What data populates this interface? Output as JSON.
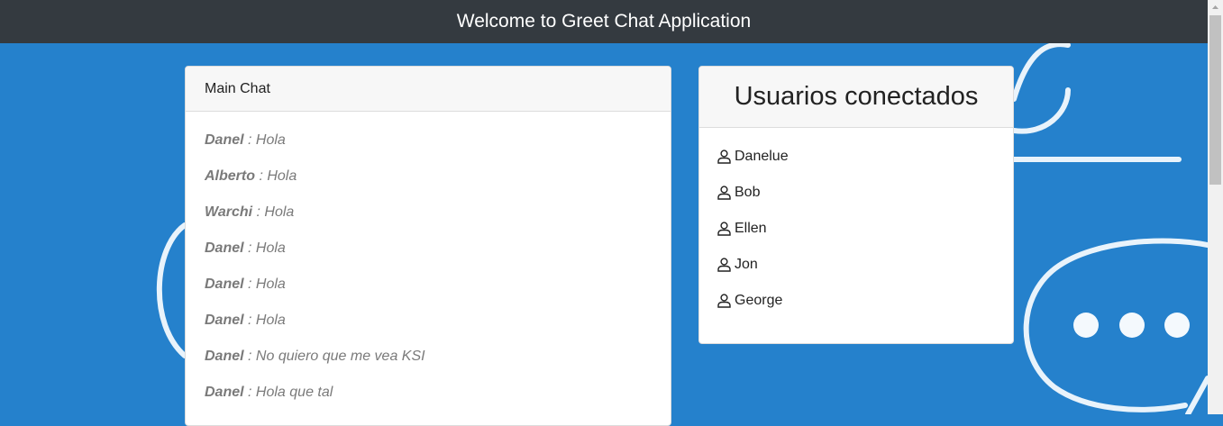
{
  "header": {
    "title": "Welcome to Greet Chat Application"
  },
  "chat": {
    "title": "Main Chat",
    "messages": [
      {
        "user": "Danel",
        "text": " : Hola"
      },
      {
        "user": "Alberto",
        "text": " : Hola"
      },
      {
        "user": "Warchi",
        "text": " : Hola"
      },
      {
        "user": "Danel",
        "text": " : Hola"
      },
      {
        "user": "Danel",
        "text": " : Hola"
      },
      {
        "user": "Danel",
        "text": " : Hola"
      },
      {
        "user": "Danel",
        "text": " : No quiero que me vea KSI"
      },
      {
        "user": "Danel",
        "text": " : Hola que tal"
      }
    ]
  },
  "users": {
    "title": "Usuarios conectados",
    "items": [
      {
        "icon": "user-icon",
        "name": "Danelue"
      },
      {
        "icon": "user-icon",
        "name": "Bob"
      },
      {
        "icon": "user-icon",
        "name": "Ellen"
      },
      {
        "icon": "user-icon",
        "name": "Jon"
      },
      {
        "icon": "user-icon",
        "name": "George"
      }
    ]
  },
  "colors": {
    "background": "#2581cc",
    "navbar": "#343a40",
    "card_header": "#f7f7f7",
    "message_text": "#7a7a7a"
  }
}
